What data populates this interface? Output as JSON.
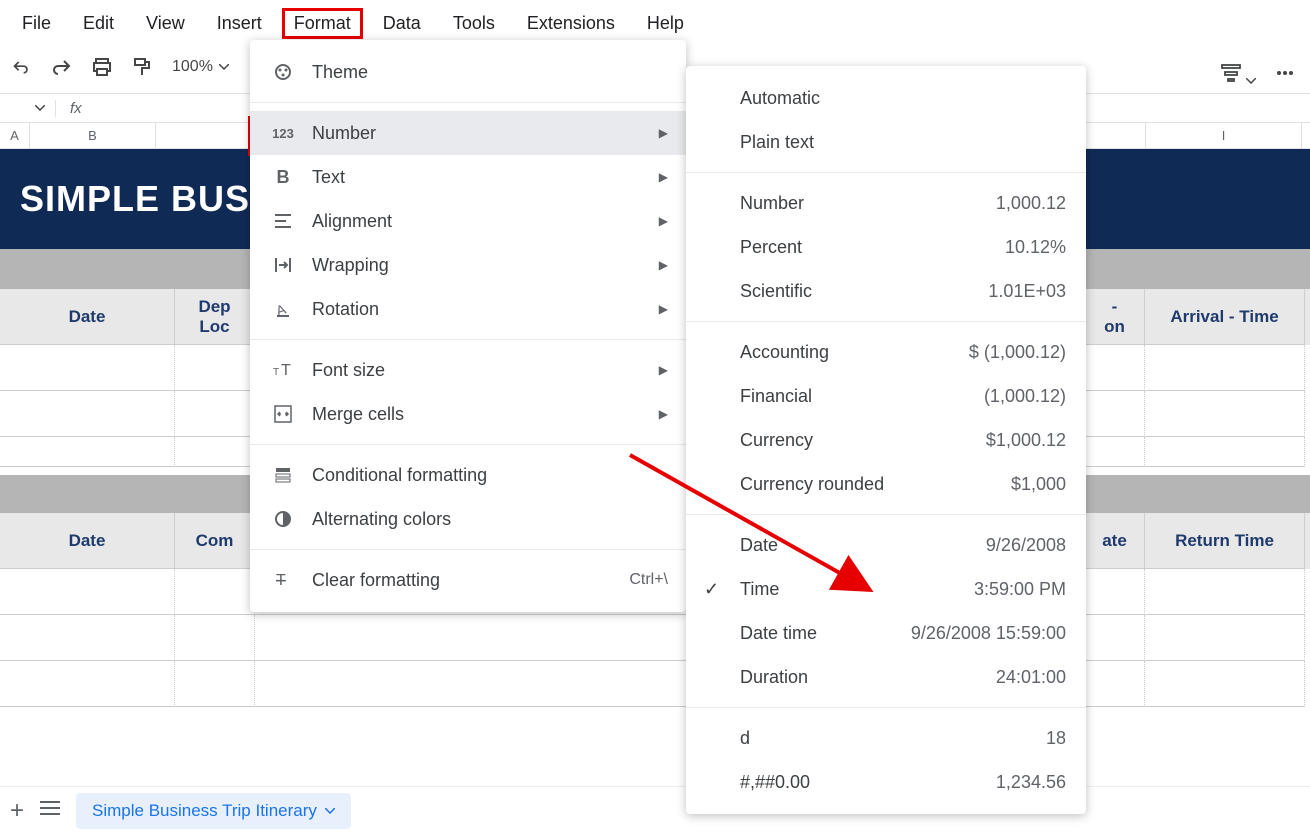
{
  "menubar": [
    "File",
    "Edit",
    "View",
    "Insert",
    "Format",
    "Data",
    "Tools",
    "Extensions",
    "Help"
  ],
  "toolbar": {
    "zoom": "100%"
  },
  "fx": {
    "label": "fx"
  },
  "colheaders": [
    "A",
    "B",
    "I"
  ],
  "sheet": {
    "title": "SIMPLE BUS",
    "headers1": [
      "Date",
      "Dep\nLoc",
      "-\non",
      "Arrival - Time"
    ],
    "headers2": [
      "Date",
      "Com",
      "ate",
      "Return Time"
    ]
  },
  "format_menu": {
    "theme": "Theme",
    "number": "Number",
    "text": "Text",
    "alignment": "Alignment",
    "wrapping": "Wrapping",
    "rotation": "Rotation",
    "fontsize": "Font size",
    "mergecells": "Merge cells",
    "conditional": "Conditional formatting",
    "alternating": "Alternating colors",
    "clear": "Clear formatting",
    "clear_shortcut": "Ctrl+\\"
  },
  "number_submenu": [
    {
      "label": "Automatic",
      "example": ""
    },
    {
      "label": "Plain text",
      "example": ""
    },
    {
      "sep": true
    },
    {
      "label": "Number",
      "example": "1,000.12"
    },
    {
      "label": "Percent",
      "example": "10.12%"
    },
    {
      "label": "Scientific",
      "example": "1.01E+03"
    },
    {
      "sep": true
    },
    {
      "label": "Accounting",
      "example": "$ (1,000.12)"
    },
    {
      "label": "Financial",
      "example": "(1,000.12)"
    },
    {
      "label": "Currency",
      "example": "$1,000.12"
    },
    {
      "label": "Currency rounded",
      "example": "$1,000"
    },
    {
      "sep": true
    },
    {
      "label": "Date",
      "example": "9/26/2008"
    },
    {
      "label": "Time",
      "example": "3:59:00 PM",
      "checked": true
    },
    {
      "label": "Date time",
      "example": "9/26/2008 15:59:00"
    },
    {
      "label": "Duration",
      "example": "24:01:00"
    },
    {
      "sep": true
    },
    {
      "label": "d",
      "example": "18"
    },
    {
      "label": "#,##0.00",
      "example": "1,234.56"
    }
  ],
  "bottombar": {
    "tab": "Simple Business Trip Itinerary"
  }
}
